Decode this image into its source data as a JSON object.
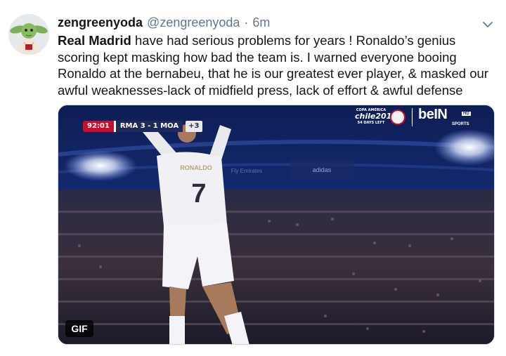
{
  "tweet": {
    "display_name": "zengreenyoda",
    "handle": "@zengreenyoda",
    "separator": "·",
    "time": "6m",
    "text_lines": {
      "l1_bold": "Real Madrid",
      "l1_rest": " have had serious problems for years ! Ronaldo’s genius",
      "l2": "scoring kept masking how bad the team is. I warned everyone booing",
      "l3": "Ronaldo at the bernabeu, that he is our greatest ever player, & masked our",
      "l4": "awful weaknesses-lack of midfield press, lack of effort & awful defense"
    },
    "avatar_icon": "yoda-avatar",
    "menu_icon": "chevron-down-icon"
  },
  "media": {
    "type": "gif",
    "badge": "GIF",
    "scoreboard": {
      "clock": "92:01",
      "score": "RMA 3 - 1 MOA",
      "extra": "+3"
    },
    "broadcaster": {
      "event_small": "COPA AMÉRICA",
      "event_big": "chile2015",
      "event_sub": "54 DAYS LEFT",
      "channel": "beIN",
      "channel_hd": "HD",
      "channel_sub": "SPORTS"
    },
    "jersey": {
      "name": "RONALDO",
      "number": "7"
    },
    "sponsor": "Fly Emirates",
    "ad_board": "adidas"
  },
  "colors": {
    "name": "#14171a",
    "secondary": "#657786",
    "clock_red": "#c8102e",
    "score_navy": "#1d2a5a"
  }
}
